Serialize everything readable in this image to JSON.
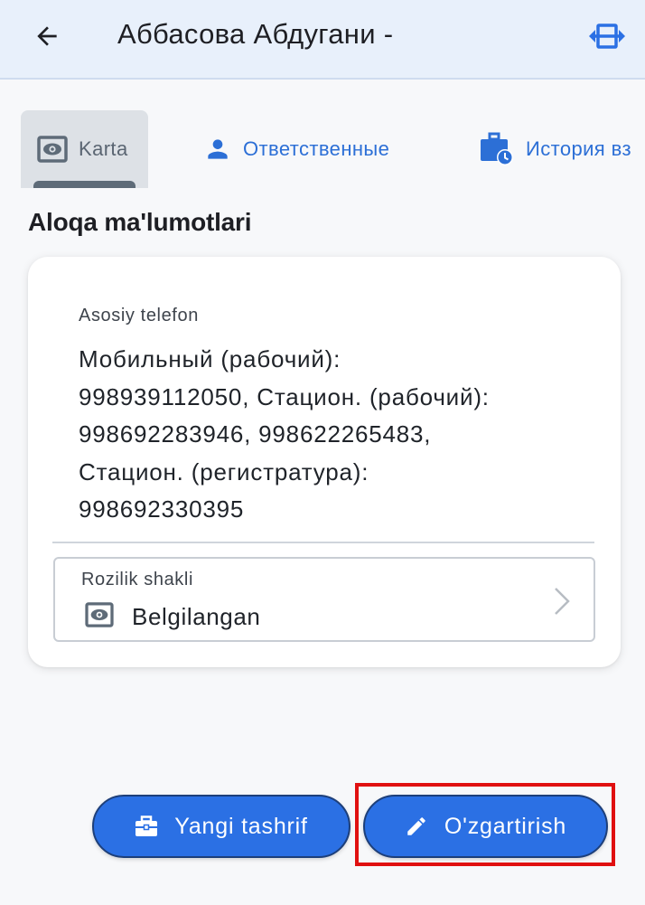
{
  "header": {
    "title": "Аббасова Абдугани -",
    "back_icon": "arrow-left-icon",
    "expand_icon": "expand-horizontal-icon"
  },
  "tabs": [
    {
      "label": "Karta",
      "icon": "eye-card-icon",
      "active": true
    },
    {
      "label": "Ответственные",
      "icon": "person-icon",
      "active": false
    },
    {
      "label": "История вз",
      "icon": "briefcase-clock-icon",
      "active": false
    }
  ],
  "section": {
    "title": "Aloqa ma'lumotlari"
  },
  "contact": {
    "phone_label": "Asosiy telefon",
    "phone_value": "Мобильный (рабочий):\n998939112050, Стацион. (рабочий):\n998692283946, 998622265483,\nСтацион. (регистратура):\n998692330395",
    "consent_label": "Rozilik shakli",
    "consent_value": "Belgilangan"
  },
  "actions": {
    "new_visit_label": "Yangi tashrif",
    "edit_label": "O'zgartirish"
  },
  "colors": {
    "accent": "#2b70e4",
    "header_bg": "#e8f0fb",
    "tab_link": "#2c6fd6",
    "highlight": "#e01010"
  }
}
